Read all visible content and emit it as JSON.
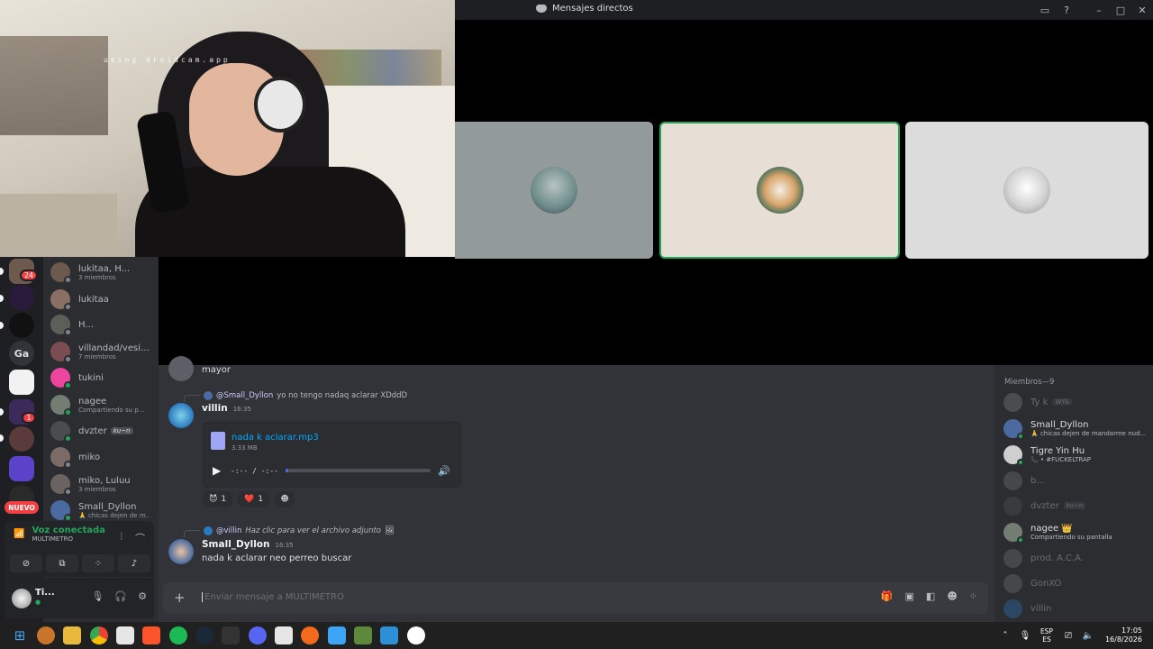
{
  "window": {
    "title": "Mensajes directos"
  },
  "webcam": {
    "watermark": "using droidcam.app"
  },
  "rail": {
    "badge_top": "24",
    "label_ga": "Ga",
    "badge_s": "1",
    "nuevo": "NUEVO"
  },
  "dms": [
    {
      "name": "lukitaa, H...",
      "sub": "3 miembros",
      "color": "#6b5a4d"
    },
    {
      "name": "lukitaa",
      "sub": "",
      "color": "#8a7064"
    },
    {
      "name": "H...",
      "sub": "",
      "color": "#5c5f58"
    },
    {
      "name": "villandad/vesiv...",
      "sub": "7 miembros",
      "color": "#7b4c52"
    },
    {
      "name": "tukini",
      "sub": "",
      "color": "#eb459e"
    },
    {
      "name": "nagee",
      "sub": "Compartiendo su p...",
      "color": "#737d72"
    },
    {
      "name": "dvzter",
      "sub": "",
      "tag": "ku~n",
      "color": "#4a4c50"
    },
    {
      "name": "miko",
      "sub": "",
      "color": "#7a6b66"
    },
    {
      "name": "miko, Luluu",
      "sub": "3 miembros",
      "color": "#6b6361"
    },
    {
      "name": "Small_Dyllon",
      "sub": "🙏 chicas dejen de m...",
      "color": "#4a6aa0"
    }
  ],
  "voice": {
    "status": "Voz conectada",
    "channel": "MULTIMETRO"
  },
  "user": {
    "name": "Ti...",
    "status": "●"
  },
  "chat": {
    "prev_text": "mayor",
    "msg1": {
      "reply_mention": "@Small_Dyllon",
      "reply_text": "yo no tengo nadaq aclarar XDddD",
      "author": "villin",
      "time": "16:35",
      "file_name": "nada k aclarar.mp3",
      "file_size": "3.33 MB",
      "player_time": "-:-- / -:--",
      "progress": 0.02,
      "reactions": [
        {
          "emoji": "😈",
          "count": "1"
        },
        {
          "emoji": "❤️",
          "count": "1"
        }
      ],
      "add_reaction": "☻"
    },
    "msg2": {
      "reply_mention": "@villin",
      "reply_text": "Haz clic para ver el archivo adjunto",
      "author": "Small_Dyllon",
      "time": "16:35",
      "text": "nada k aclarar neo perreo buscar"
    },
    "input_placeholder": "Enviar mensaje a MULTIMETRO"
  },
  "members": {
    "header": "Miembros—9",
    "list": [
      {
        "name": "Ty k",
        "sub": "",
        "tag": "WYA",
        "color": "#888",
        "off": true
      },
      {
        "name": "Small_Dyllon",
        "sub": "🙏 chicas dejen de mandarme nud...",
        "color": "#4a6aa0",
        "off": false
      },
      {
        "name": "Tigre Yin Hu",
        "sub": "📞 • #FUCKELTRAP",
        "color": "#cfcfcf",
        "off": false
      },
      {
        "name": "b...",
        "sub": "",
        "color": "#777",
        "off": true
      },
      {
        "name": "dvzter",
        "sub": "",
        "tag": "ku~n",
        "color": "#555",
        "off": true
      },
      {
        "name": "nagee 👑",
        "sub": "Compartiendo su pantalla",
        "color": "#737d72",
        "off": false
      },
      {
        "name": "prod. A.C.A.",
        "sub": "",
        "color": "#777",
        "off": true
      },
      {
        "name": "GonXO",
        "sub": "",
        "color": "#777",
        "off": true
      },
      {
        "name": "villin",
        "sub": "",
        "color": "#2a7ac0",
        "off": true
      }
    ]
  },
  "taskbar": {
    "lang_top": "ESP",
    "lang_bottom": "ES",
    "time": "17:05",
    "date": "16/8/2026"
  },
  "colors": {
    "online": "#23a55a",
    "accent": "#5865f2",
    "link": "#00a8fc",
    "danger": "#f23f43"
  }
}
